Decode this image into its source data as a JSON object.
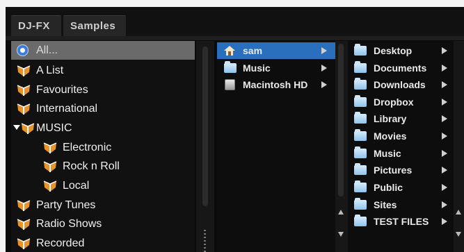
{
  "tabs": [
    {
      "label": "DJ-FX",
      "active": true
    },
    {
      "label": "Samples",
      "active": false
    }
  ],
  "categories": [
    {
      "label": "All...",
      "icon": "radio-icon",
      "selected": true
    },
    {
      "label": "A List",
      "icon": "crate-icon"
    },
    {
      "label": "Favourites",
      "icon": "crate-icon"
    },
    {
      "label": "International",
      "icon": "crate-icon"
    },
    {
      "label": "MUSIC",
      "icon": "crate-icon",
      "expanded": true
    },
    {
      "label": "Electronic",
      "icon": "crate-icon",
      "indent": 1
    },
    {
      "label": "Rock n Roll",
      "icon": "crate-icon",
      "indent": 1
    },
    {
      "label": "Local",
      "icon": "crate-icon",
      "indent": 1
    },
    {
      "label": "Party Tunes",
      "icon": "crate-icon"
    },
    {
      "label": "Radio Shows",
      "icon": "crate-icon"
    },
    {
      "label": "Recorded",
      "icon": "crate-icon"
    }
  ],
  "locations": [
    {
      "label": "sam",
      "icon": "home-icon",
      "selected": true
    },
    {
      "label": "Music",
      "icon": "folder-icon"
    },
    {
      "label": "Macintosh HD",
      "icon": "hard-drive-icon"
    }
  ],
  "folders": [
    {
      "label": "Desktop"
    },
    {
      "label": "Documents"
    },
    {
      "label": "Downloads"
    },
    {
      "label": "Dropbox"
    },
    {
      "label": "Library"
    },
    {
      "label": "Movies"
    },
    {
      "label": "Music"
    },
    {
      "label": "Pictures"
    },
    {
      "label": "Public"
    },
    {
      "label": "Sites"
    },
    {
      "label": "TEST FILES"
    }
  ],
  "colors": {
    "selection_blue": "#2a6fbd",
    "selection_gray": "#6a6a6a",
    "crate_orange": "#e8922a",
    "background": "#0d0d0d"
  }
}
